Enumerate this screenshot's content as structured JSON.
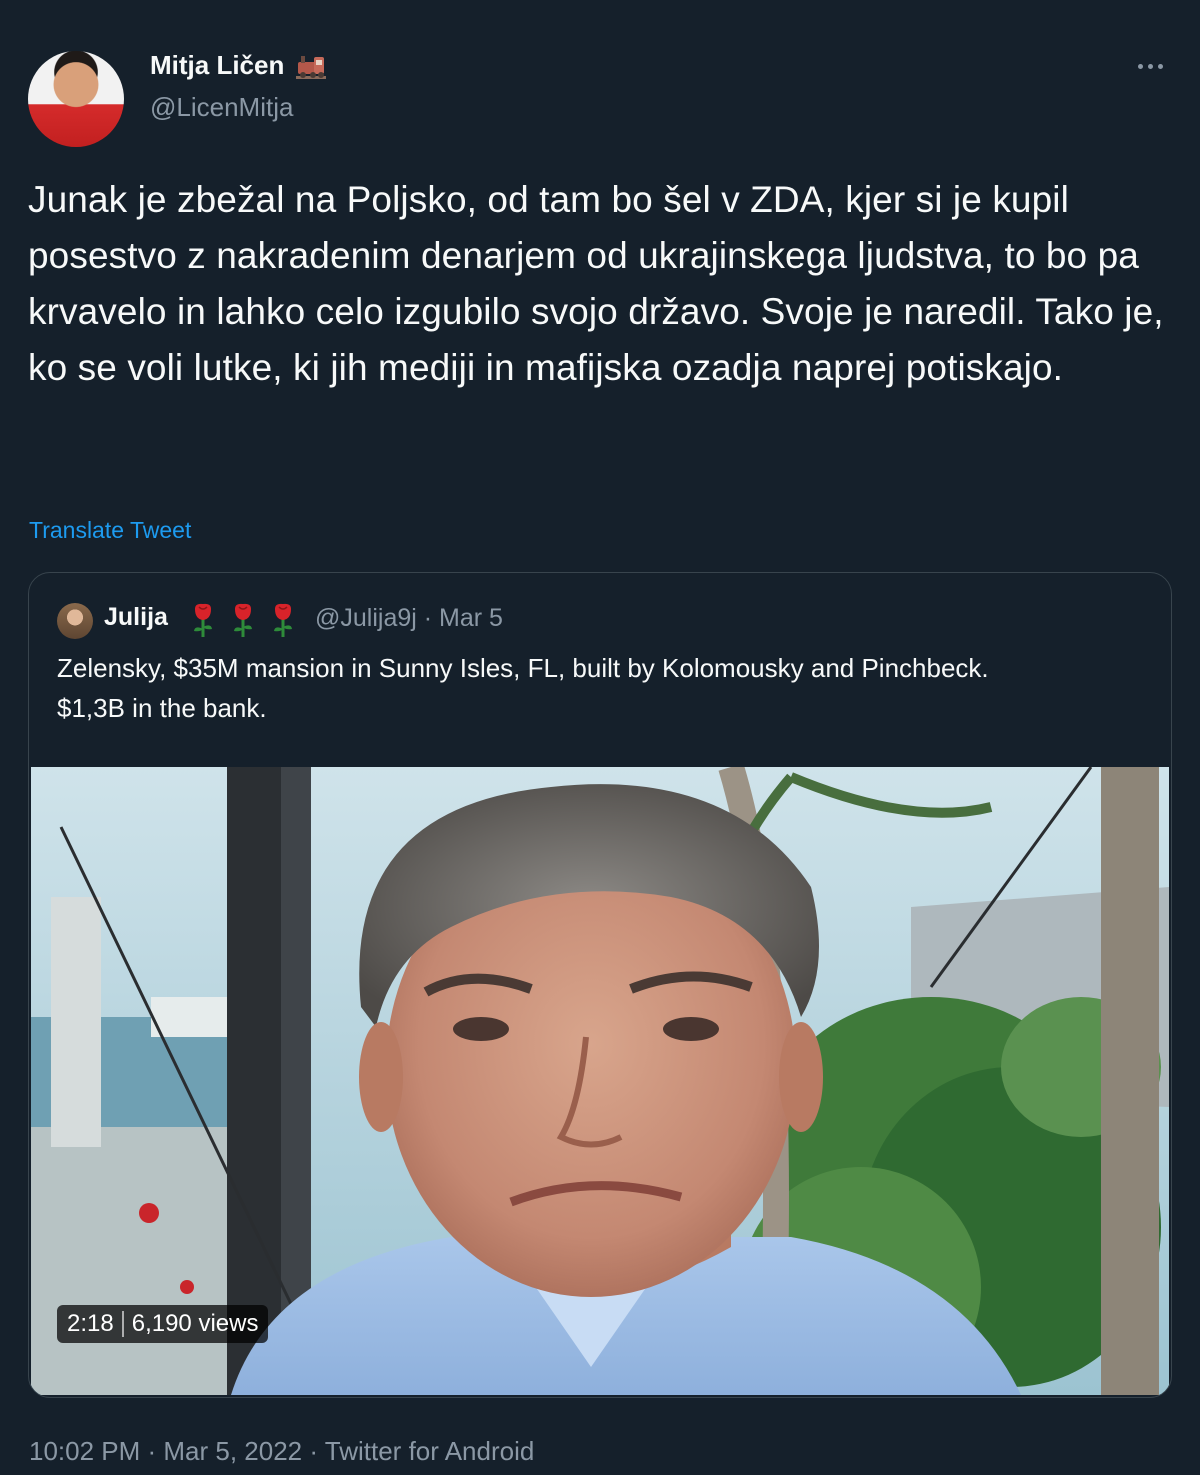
{
  "author": {
    "name": "Mitja Ličen",
    "handle": "@LicenMitja",
    "badge_icon": "train-icon"
  },
  "menu": {
    "icon": "more-horizontal-icon"
  },
  "tweet_text": "Junak je zbežal na Poljsko, od tam bo šel v ZDA, kjer si je kupil posestvo z nakradenim denarjem od ukrajinskega ljudstva, to bo pa krvavelo in lahko celo izgubilo svojo državo. Svoje je naredil. Tako je, ko se voli lutke, ki jih mediji in mafijska ozadja naprej potiskajo.",
  "translate_label": "Translate Tweet",
  "quote": {
    "name": "Julija",
    "emoji_icons": [
      "rose-icon",
      "rose-icon",
      "rose-icon"
    ],
    "meta": "@Julija9j · Mar 5",
    "text": "Zelensky, $35M mansion in Sunny Isles, FL, built by Kolomousky and Pinchbeck.\n$1,3B  in the bank.",
    "video": {
      "duration": "2:18",
      "views": "6,190 views"
    }
  },
  "timestamp": "10:02 PM · Mar 5, 2022 · Twitter for Android",
  "colors": {
    "background": "#15202b",
    "text": "#f7f9f9",
    "secondary": "#8b98a5",
    "link": "#1d9bf0",
    "border": "#38444d"
  }
}
